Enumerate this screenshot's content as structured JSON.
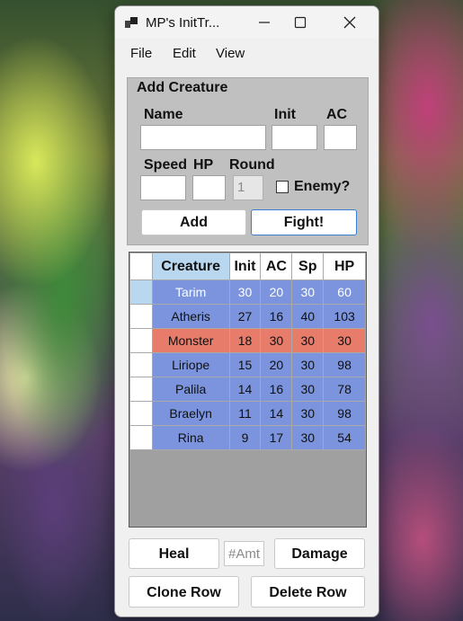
{
  "window": {
    "title": "MP's InitTr..."
  },
  "menu": {
    "items": [
      "File",
      "Edit",
      "View"
    ]
  },
  "add_creature": {
    "group_title": "Add Creature",
    "labels": {
      "name": "Name",
      "init": "Init",
      "ac": "AC",
      "speed": "Speed",
      "hp": "HP",
      "round": "Round"
    },
    "fields": {
      "name": "",
      "init": "",
      "ac": "",
      "speed": "",
      "hp": "",
      "round": "1"
    },
    "enemy_checkbox": {
      "label": "Enemy?",
      "checked": false
    },
    "buttons": {
      "add": "Add",
      "fight": "Fight!"
    }
  },
  "grid": {
    "columns": [
      "Creature",
      "Init",
      "AC",
      "Sp",
      "HP"
    ],
    "rows": [
      {
        "creature": "Tarim",
        "init": "30",
        "ac": "20",
        "sp": "30",
        "hp": "60",
        "enemy": false,
        "selected": true
      },
      {
        "creature": "Atheris",
        "init": "27",
        "ac": "16",
        "sp": "40",
        "hp": "103",
        "enemy": false
      },
      {
        "creature": "Monster",
        "init": "18",
        "ac": "30",
        "sp": "30",
        "hp": "30",
        "enemy": true
      },
      {
        "creature": "Liriope",
        "init": "15",
        "ac": "20",
        "sp": "30",
        "hp": "98",
        "enemy": false
      },
      {
        "creature": "Palila",
        "init": "14",
        "ac": "16",
        "sp": "30",
        "hp": "78",
        "enemy": false
      },
      {
        "creature": "Braelyn",
        "init": "11",
        "ac": "14",
        "sp": "30",
        "hp": "98",
        "enemy": false
      },
      {
        "creature": "Rina",
        "init": "9",
        "ac": "17",
        "sp": "30",
        "hp": "54",
        "enemy": false
      }
    ],
    "colors": {
      "ally": "#7b94dd",
      "enemy": "#e77c6a",
      "selected": "#b9d8f0"
    }
  },
  "actions": {
    "heal": "Heal",
    "amount_placeholder": "#Amt",
    "damage": "Damage",
    "clone_row": "Clone Row",
    "delete_row": "Delete Row"
  }
}
